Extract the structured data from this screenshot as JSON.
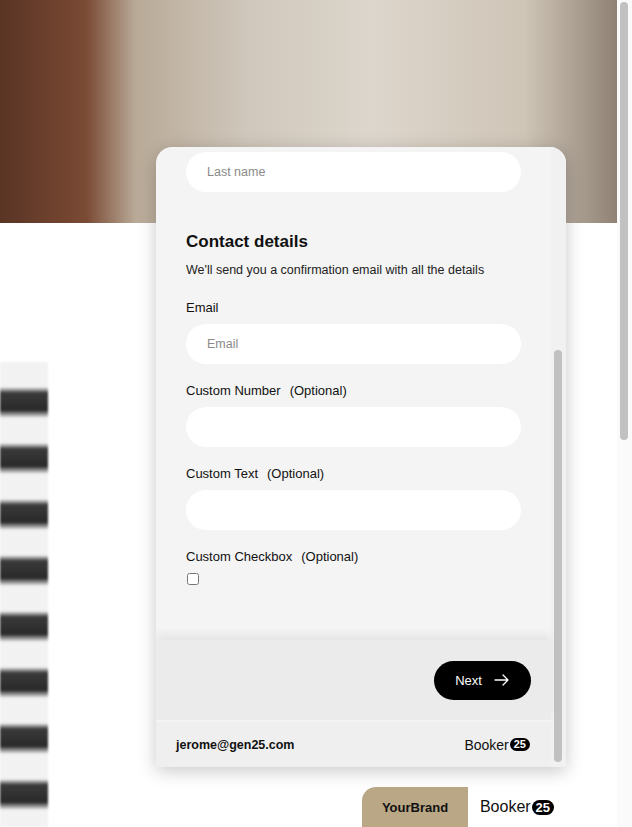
{
  "last_name_field": {
    "placeholder": "Last name"
  },
  "contact_section": {
    "title": "Contact details",
    "subtitle": "We'll send you a confirmation email with all the details"
  },
  "fields": [
    {
      "kind": "input",
      "label": "Email",
      "placeholder": "Email"
    },
    {
      "kind": "input",
      "label": "Custom Number",
      "optional": "(Optional)"
    },
    {
      "kind": "input",
      "label": "Custom Text",
      "optional": "(Optional)"
    },
    {
      "kind": "checkbox",
      "label": "Custom Checkbox",
      "optional": "(Optional)",
      "checked": false
    }
  ],
  "next_button": {
    "label": "Next"
  },
  "footer": {
    "user_email": "jerome@gen25.com",
    "logo": {
      "word": "Booker",
      "badge": "25"
    }
  },
  "brand_tab": {
    "brand": "YourBrand",
    "logo": {
      "word": "Booker",
      "badge": "25"
    }
  }
}
